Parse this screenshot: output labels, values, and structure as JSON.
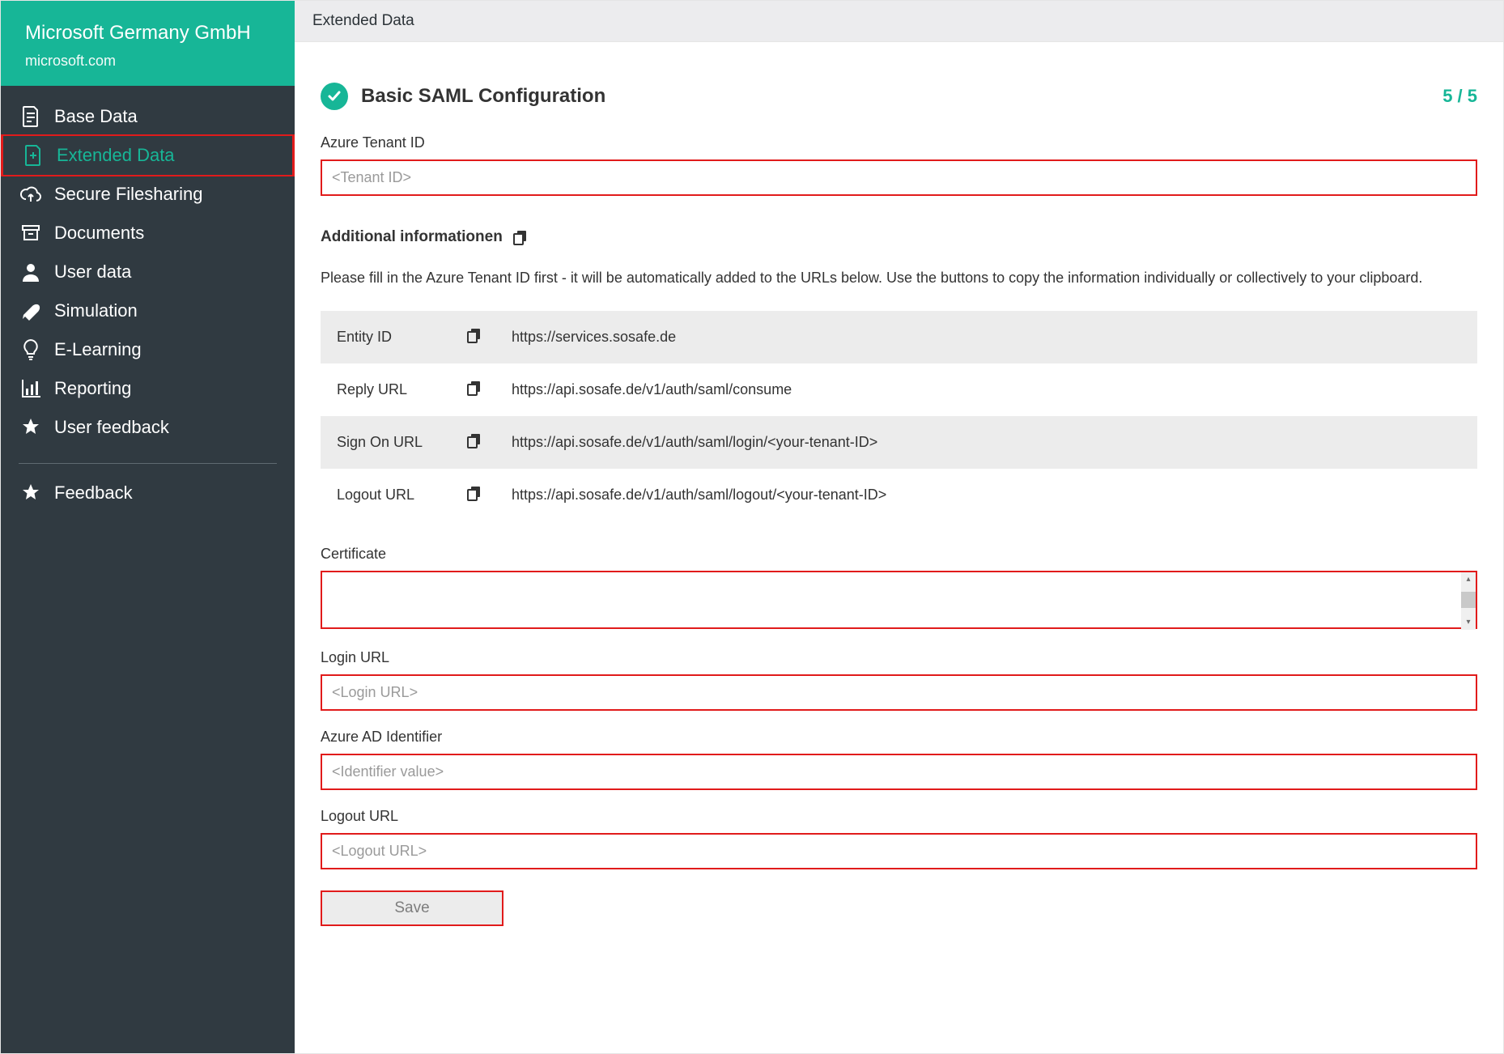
{
  "sidebar": {
    "company": "Microsoft Germany GmbH",
    "domain": "microsoft.com",
    "items": [
      {
        "id": "base-data",
        "label": "Base Data",
        "icon": "document-icon"
      },
      {
        "id": "extended-data",
        "label": "Extended Data",
        "icon": "document-plus-icon"
      },
      {
        "id": "secure-filesharing",
        "label": "Secure Filesharing",
        "icon": "cloud-upload-icon"
      },
      {
        "id": "documents",
        "label": "Documents",
        "icon": "archive-icon"
      },
      {
        "id": "user-data",
        "label": "User data",
        "icon": "user-icon"
      },
      {
        "id": "simulation",
        "label": "Simulation",
        "icon": "rocket-icon"
      },
      {
        "id": "e-learning",
        "label": "E-Learning",
        "icon": "lightbulb-icon"
      },
      {
        "id": "reporting",
        "label": "Reporting",
        "icon": "bar-chart-icon"
      },
      {
        "id": "user-feedback",
        "label": "User feedback",
        "icon": "star-icon"
      }
    ],
    "footer_item": {
      "id": "feedback",
      "label": "Feedback",
      "icon": "star-icon"
    }
  },
  "topbar": {
    "breadcrumb": "Extended Data"
  },
  "section": {
    "title": "Basic SAML Configuration",
    "counter": "5 / 5"
  },
  "fields": {
    "tenant_id": {
      "label": "Azure Tenant ID",
      "placeholder": "<Tenant ID>"
    },
    "additional_info_heading": "Additional informationen",
    "helptext": "Please fill in the Azure Tenant ID first - it will be automatically added to the URLs below. Use the buttons to copy the information individually or collectively to your clipboard.",
    "info_rows": [
      {
        "label": "Entity ID",
        "value": "https://services.sosafe.de"
      },
      {
        "label": "Reply URL",
        "value": "https://api.sosafe.de/v1/auth/saml/consume"
      },
      {
        "label": "Sign On URL",
        "value": "https://api.sosafe.de/v1/auth/saml/login/<your-tenant-ID>"
      },
      {
        "label": "Logout URL",
        "value": "https://api.sosafe.de/v1/auth/saml/logout/<your-tenant-ID>"
      }
    ],
    "certificate": {
      "label": "Certificate"
    },
    "login_url": {
      "label": "Login URL",
      "placeholder": "<Login URL>"
    },
    "azure_ad_identifier": {
      "label": "Azure AD Identifier",
      "placeholder": "<Identifier value>"
    },
    "logout_url": {
      "label": "Logout URL",
      "placeholder": "<Logout URL>"
    },
    "save_label": "Save"
  }
}
